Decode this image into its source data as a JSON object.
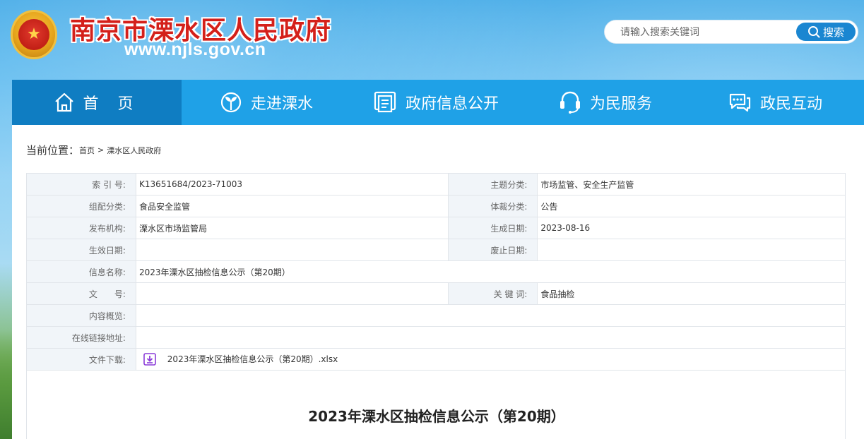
{
  "header": {
    "site_title": "南京市溧水区人民政府",
    "site_url": "www.njls.gov.cn",
    "search_placeholder": "请输入搜索关键词",
    "search_button": "搜索"
  },
  "nav": {
    "items": [
      {
        "label": "首 页",
        "icon": "home-icon",
        "active": true
      },
      {
        "label": "走进溧水",
        "icon": "sprout-icon",
        "active": false
      },
      {
        "label": "政府信息公开",
        "icon": "document-icon",
        "active": false
      },
      {
        "label": "为民服务",
        "icon": "headset-icon",
        "active": false
      },
      {
        "label": "政民互动",
        "icon": "chat-icon",
        "active": false
      }
    ]
  },
  "breadcrumb": {
    "label": "当前位置：",
    "items": [
      "首页",
      "溧水区人民政府"
    ],
    "separator": ">"
  },
  "meta": {
    "index_no_label": "索 引 号:",
    "index_no": "K13651684/2023-71003",
    "topic_label": "主题分类:",
    "topic": "市场监管、安全生产监管",
    "group_label": "组配分类:",
    "group": "食品安全监管",
    "genre_label": "体裁分类:",
    "genre": "公告",
    "publisher_label": "发布机构:",
    "publisher": "溧水区市场监管局",
    "created_label": "生成日期:",
    "created": "2023-08-16",
    "effective_label": "生效日期:",
    "effective": "",
    "abolish_label": "废止日期:",
    "abolish": "",
    "name_label": "信息名称:",
    "name": "2023年溧水区抽检信息公示（第20期）",
    "doc_no_label": "文　　号:",
    "doc_no": "",
    "keywords_label": "关 键 词:",
    "keywords": "食品抽检",
    "summary_label": "内容概览:",
    "summary": "",
    "online_link_label": "在线链接地址:",
    "online_link": "",
    "download_label": "文件下载:",
    "download_file": "2023年溧水区抽检信息公示（第20期）.xlsx"
  },
  "document": {
    "title": "2023年溧水区抽检信息公示（第20期）"
  },
  "colors": {
    "brand_red": "#d4201a",
    "nav_blue": "#1fa1e7",
    "nav_active": "#0f7dc2",
    "search_blue": "#1a86d1",
    "download_icon": "#8a3bd8"
  }
}
